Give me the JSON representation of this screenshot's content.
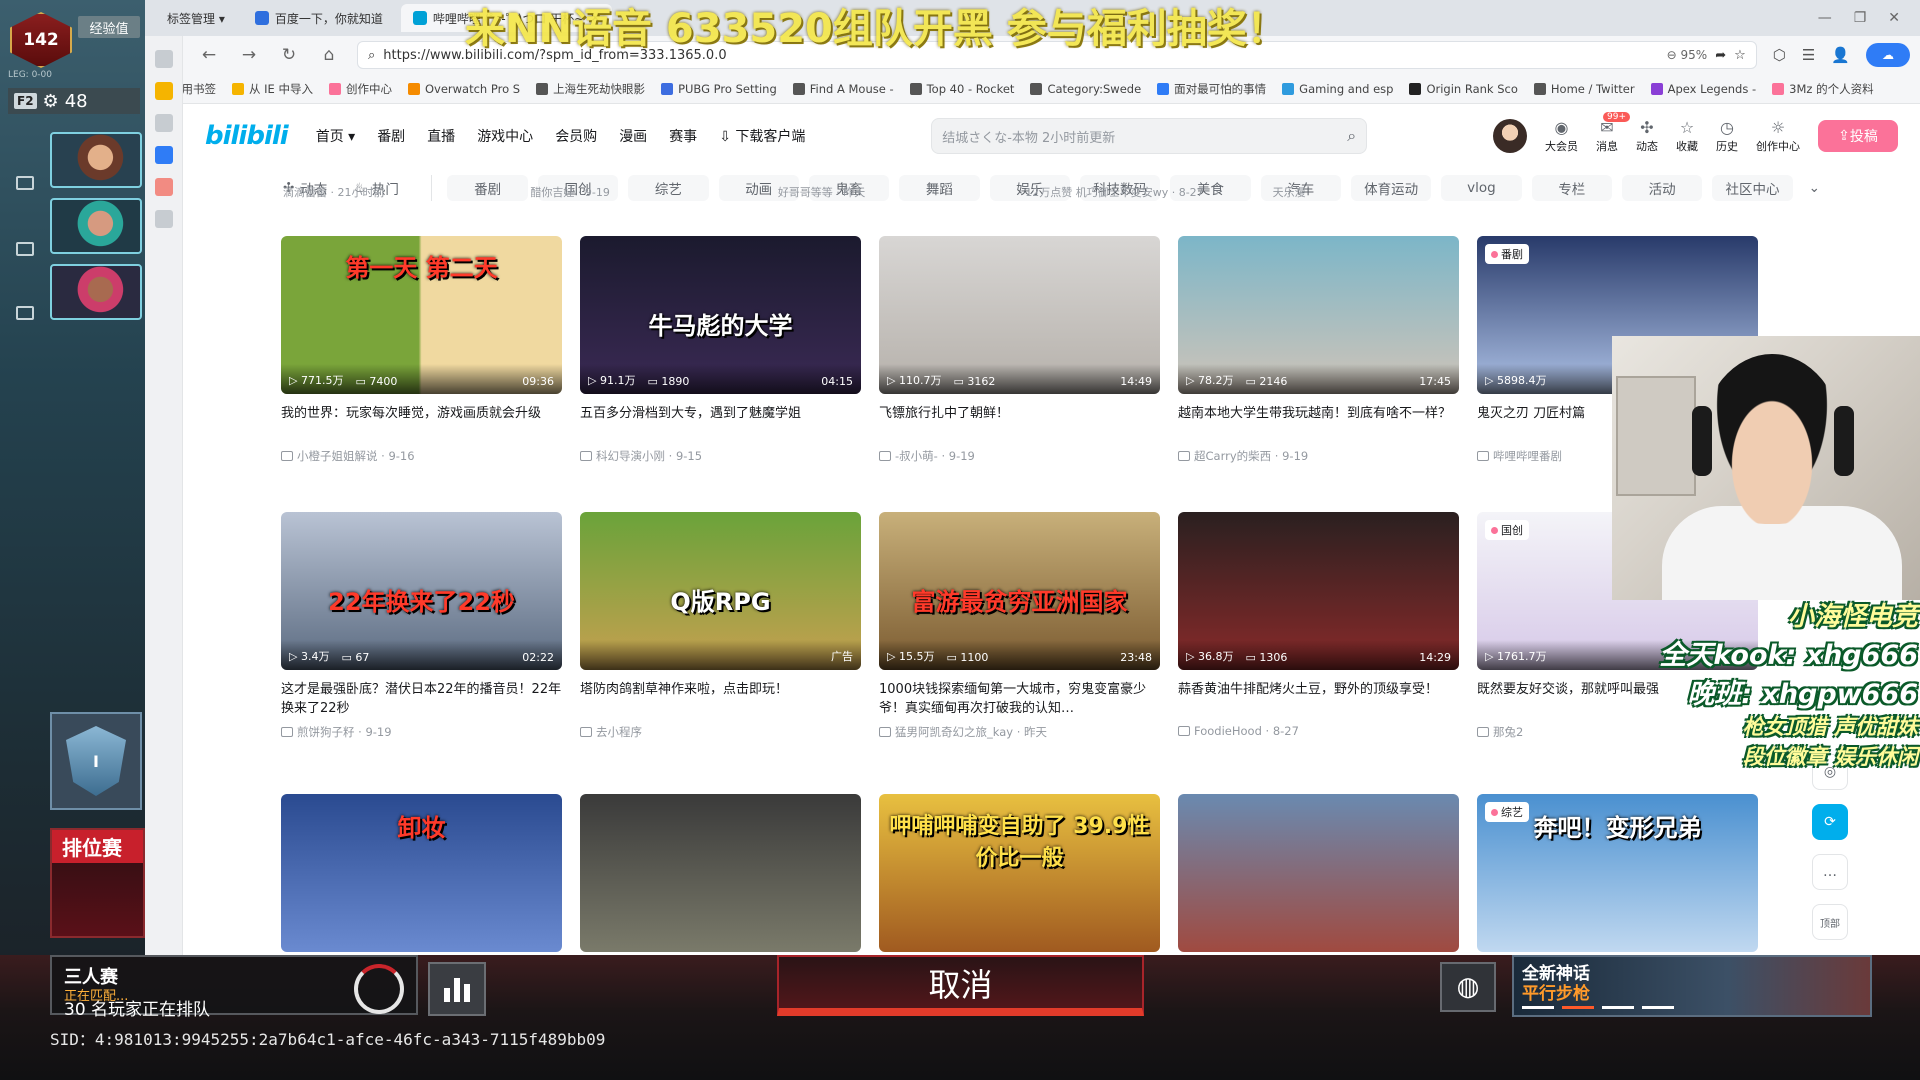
{
  "overlay": {
    "top_banner": "来NN语音 633520组队开黑 参与福利抽奖！",
    "stream_promo": {
      "l1": "小海怪电竞",
      "l2": "全天kook: xhg666",
      "l3": "晚班: xhgpw666",
      "l4": "枪女顶猎 声优甜妹",
      "l5": "段位徽章 娱乐休闲"
    }
  },
  "game": {
    "level": "142",
    "xp_label": "经验值",
    "xp_small": "LEG: 0-00",
    "squad_key": "F2",
    "squad_count": "48",
    "rank_numeral": "I",
    "ranked_title": "排位赛",
    "mode": "三人赛",
    "matching": "正在匹配...",
    "players_queue": "30 名玩家正在排队",
    "cancel_label": "取消",
    "promo_t1": "全新神话",
    "promo_t2": "平行步枪",
    "sid": "SID：4:981013:9945255:2a7b64c1-afce-46fc-a343-7115f489bb09"
  },
  "browser": {
    "tabs": [
      {
        "label": "标签管理 ▾"
      },
      {
        "label": "百度一下，你就知道"
      },
      {
        "label": "哔哩哔哩 (゜-゜)つロ 干杯~"
      }
    ],
    "url": "https://www.bilibili.com/?spm_id_from=333.1365.0.0",
    "zoom": "95%",
    "bookmarks": [
      {
        "label": "常用书签",
        "color": "#f5b400"
      },
      {
        "label": "从 IE 中导入",
        "color": "#f5b400"
      },
      {
        "label": "创作中心",
        "color": "#fb7299"
      },
      {
        "label": "Overwatch Pro S",
        "color": "#f58b00"
      },
      {
        "label": "上海生死劫快眼影",
        "color": "#555555"
      },
      {
        "label": "PUBG Pro Setting",
        "color": "#3d6de0"
      },
      {
        "label": "Find A Mouse -",
        "color": "#555555"
      },
      {
        "label": "Top 40 - Rocket",
        "color": "#555555"
      },
      {
        "label": "Category:Swede",
        "color": "#555555"
      },
      {
        "label": "面对最可怕的事情",
        "color": "#2f7cf6"
      },
      {
        "label": "Gaming and esp",
        "color": "#2f9bde"
      },
      {
        "label": "Origin Rank Sco",
        "color": "#222222"
      },
      {
        "label": "Home / Twitter",
        "color": "#555555"
      },
      {
        "label": "Apex Legends -",
        "color": "#8a3fd6"
      },
      {
        "label": "3Mz 的个人资料",
        "color": "#fb7299"
      }
    ]
  },
  "bili": {
    "logo": "bilibili",
    "nav": [
      "首页 ▾",
      "番剧",
      "直播",
      "游戏中心",
      "会员购",
      "漫画",
      "赛事",
      "下载客户端"
    ],
    "search_placeholder": "结城さくな-本物 2小时前更新",
    "header_items": [
      {
        "label": "大会员",
        "icon": "vip-icon"
      },
      {
        "label": "消息",
        "icon": "message-icon",
        "badge": "99+"
      },
      {
        "label": "动态",
        "icon": "dynamic-icon"
      },
      {
        "label": "收藏",
        "icon": "star-icon"
      },
      {
        "label": "历史",
        "icon": "history-icon"
      },
      {
        "label": "创作中心",
        "icon": "bulb-icon"
      }
    ],
    "upload_label": "投稿",
    "channel_main": [
      "动态",
      "热门"
    ],
    "channels": [
      "番剧",
      "国创",
      "综艺",
      "动画",
      "鬼畜",
      "舞蹈",
      "娱乐",
      "科技数码",
      "美食",
      "汽车",
      "体育运动",
      "vlog",
      "专栏",
      "活动",
      "社区中心"
    ],
    "prev_meta": [
      "滴滴蕾蕾 · 21小时前",
      "醋你吉娃 · 9-19",
      "好哥哥等等 · 昨天",
      "12万点赞  机巧御士不变安wy · 8-27",
      "天乐漫"
    ],
    "cards_row1": [
      {
        "views": "771.5万",
        "danmaku": "7400",
        "duration": "09:36",
        "title": "我的世界：玩家每次睡觉，游戏画质就会升级",
        "up": "小橙子姐姐解说 · 9-16",
        "overlay": "第一天   第二天"
      },
      {
        "views": "91.1万",
        "danmaku": "1890",
        "duration": "04:15",
        "title": "五百多分滑档到大专，遇到了魅魔学姐",
        "up": "科幻导演小刚 · 9-15",
        "overlay": "牛马彪的大学"
      },
      {
        "views": "110.7万",
        "danmaku": "3162",
        "duration": "14:49",
        "title": "飞镖旅行扎中了朝鲜！",
        "up": "-叔小萌- · 9-19",
        "overlay": ""
      },
      {
        "views": "78.2万",
        "danmaku": "2146",
        "duration": "17:45",
        "title": "越南本地大学生带我玩越南！到底有啥不一样？",
        "up": "超Carry的柴西 · 9-19",
        "overlay": ""
      },
      {
        "views": "5898.4万",
        "danmaku": "",
        "duration": "",
        "title": "鬼灭之刃 刀匠村篇",
        "up": "哔哩哔哩番剧",
        "tag": "番剧",
        "overlay": ""
      }
    ],
    "cards_row2": [
      {
        "views": "3.4万",
        "danmaku": "67",
        "duration": "02:22",
        "title": "这才是最强卧底？潜伏日本22年的播音员！22年换来了22秒",
        "up": "煎饼狗子籽 · 9-19",
        "overlay": "22年换来了22秒"
      },
      {
        "views": "",
        "danmaku": "",
        "duration": "广告",
        "title": "塔防肉鸽割草神作来啦，点击即玩！",
        "up": "去小程序",
        "overlay": "Q版RPG"
      },
      {
        "views": "15.5万",
        "danmaku": "1100",
        "duration": "23:48",
        "title": "1000块钱探索缅甸第一大城市，穷鬼变富豪少爷！真实缅甸再次打破我的认知…",
        "up": "猛男阿凯奇幻之旅_kay · 昨天",
        "overlay": "富游最贫穷亚洲国家"
      },
      {
        "views": "36.8万",
        "danmaku": "1306",
        "duration": "14:29",
        "title": "蒜香黄油牛排配烤火土豆，野外的顶级享受！",
        "up": "FoodieHood · 8-27",
        "overlay": ""
      },
      {
        "views": "1761.7万",
        "danmaku": "",
        "duration": "",
        "title": "既然要友好交谈，那就呼叫最强",
        "up": "那兔2",
        "tag": "国创",
        "overlay": ""
      }
    ],
    "cards_row3": [
      {
        "overlay": "卸妆"
      },
      {
        "overlay": ""
      },
      {
        "overlay": "呷哺呷哺变自助了  39.9性价比一般"
      },
      {
        "overlay": ""
      },
      {
        "overlay": "奔吧！变形兄弟",
        "tag": "综艺"
      }
    ],
    "float_tools": [
      "◎",
      "⟳",
      "…",
      "顶部"
    ]
  }
}
